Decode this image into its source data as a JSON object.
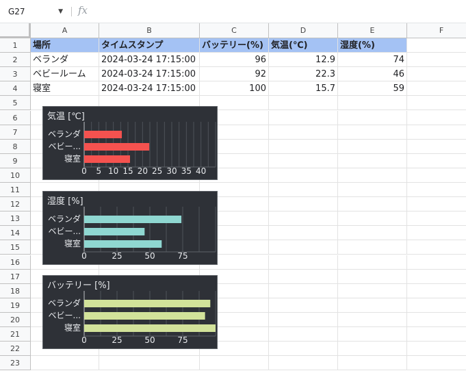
{
  "name_box": "G27",
  "formula": "",
  "columns": [
    "A",
    "B",
    "C",
    "D",
    "E",
    "F"
  ],
  "rows": [
    "1",
    "2",
    "3",
    "4",
    "5",
    "6",
    "7",
    "8",
    "9",
    "10",
    "11",
    "12",
    "13",
    "14",
    "15",
    "16",
    "17",
    "18",
    "19",
    "20",
    "21",
    "22",
    "23"
  ],
  "table": {
    "headers": [
      "場所",
      "タイムスタンプ",
      "バッテリー(%)",
      "気温(℃)",
      "湿度(%)"
    ],
    "rows": [
      [
        "ベランダ",
        "2024-03-24 17:15:00",
        "96",
        "12.9",
        "74"
      ],
      [
        "ベビールーム",
        "2024-03-24 17:15:00",
        "92",
        "22.3",
        "46"
      ],
      [
        "寝室",
        "2024-03-24 17:15:00",
        "100",
        "15.7",
        "59"
      ]
    ]
  },
  "colors": {
    "temperature": "#f5524f",
    "humidity": "#8fd7d1",
    "battery": "#d2e29a",
    "chart_bg": "#2e3137",
    "header_fill": "#a4c2f4"
  },
  "chart_data": [
    {
      "type": "bar",
      "orientation": "horizontal",
      "title": "気温 [℃]",
      "categories": [
        "ベランダ",
        "ベビー...",
        "寝室"
      ],
      "values": [
        12.9,
        22.3,
        15.7
      ],
      "xlim": [
        0,
        45
      ],
      "ticks": [
        "0",
        "5",
        "10",
        "15",
        "20",
        "25",
        "30",
        "35",
        "40"
      ],
      "grid": true
    },
    {
      "type": "bar",
      "orientation": "horizontal",
      "title": "湿度 [%]",
      "categories": [
        "ベランダ",
        "ベビー...",
        "寝室"
      ],
      "values": [
        74,
        46,
        59
      ],
      "xlim": [
        0,
        100
      ],
      "ticks": [
        "0",
        "25",
        "50",
        "75"
      ],
      "grid": true
    },
    {
      "type": "bar",
      "orientation": "horizontal",
      "title": "バッテリー [%]",
      "categories": [
        "ベランダ",
        "ベビー...",
        "寝室"
      ],
      "values": [
        96,
        92,
        100
      ],
      "xlim": [
        0,
        100
      ],
      "ticks": [
        "0",
        "25",
        "50",
        "75"
      ],
      "grid": true
    }
  ]
}
